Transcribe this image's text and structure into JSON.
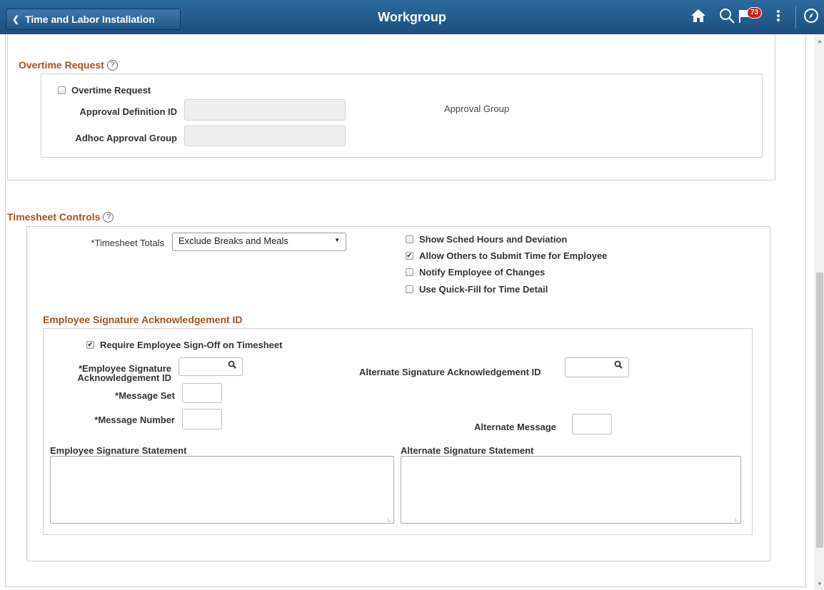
{
  "header": {
    "back_label": "Time and Labor Installation",
    "title": "Workgroup",
    "notification_count": "73"
  },
  "overtime": {
    "section_title": "Overtime Request",
    "checkbox_label": "Overtime Request",
    "approval_def_label": "Approval Definition ID",
    "approval_group_label": "Approval Group",
    "adhoc_label": "Adhoc Approval Group"
  },
  "timesheet": {
    "section_title": "Timesheet Controls",
    "totals_label": "*Timesheet Totals",
    "totals_value": "Exclude Breaks and Meals",
    "options": [
      {
        "label": "Show Sched Hours and Deviation",
        "checked": false
      },
      {
        "label": "Allow Others to Submit Time for Employee",
        "checked": true
      },
      {
        "label": "Notify Employee of Changes",
        "checked": false
      },
      {
        "label": "Use Quick-Fill for Time Detail",
        "checked": false
      }
    ]
  },
  "signature": {
    "section_title": "Employee Signature Acknowledgement ID",
    "require_label": "Require Employee Sign-Off on Timesheet",
    "emp_sig_label_1": "*Employee Signature",
    "emp_sig_label_2": "Acknowledgement ID",
    "alt_sig_label": "Alternate Signature Acknowledgement ID",
    "msg_set_label": "*Message Set",
    "msg_num_label": "*Message Number",
    "alt_msg_label": "Alternate Message",
    "emp_statement_label": "Employee Signature Statement",
    "alt_statement_label": "Alternate Signature Statement"
  }
}
